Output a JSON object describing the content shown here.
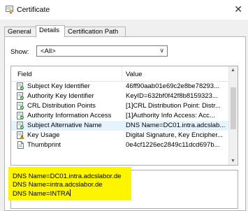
{
  "window": {
    "title": "Certificate"
  },
  "tabs": [
    "General",
    "Details",
    "Certification Path"
  ],
  "show": {
    "label": "Show:",
    "value": "<All>"
  },
  "list": {
    "columns": [
      "Field",
      "Value"
    ],
    "rows": [
      {
        "field": "Subject Key Identifier",
        "value": "46ff90aab01e69c2e8be78293...",
        "icon": "extension-icon"
      },
      {
        "field": "Authority Key Identifier",
        "value": "KeyID=632bf0f42f8b8159323...",
        "icon": "extension-icon"
      },
      {
        "field": "CRL Distribution Points",
        "value": "[1]CRL Distribution Point: Distr...",
        "icon": "extension-icon"
      },
      {
        "field": "Authority Information Access",
        "value": "[1]Authority Info Access: Acc...",
        "icon": "extension-icon"
      },
      {
        "field": "Subject Alternative Name",
        "value": "DNS Name=DC01.intra.adcslab...",
        "icon": "extension-icon",
        "selected": true
      },
      {
        "field": "Key Usage",
        "value": "Digital Signature, Key Encipher...",
        "icon": "critical-extension-icon"
      },
      {
        "field": "Thumbprint",
        "value": "0e4cf1226ec2849c11dcd697b...",
        "icon": "document-icon"
      }
    ]
  },
  "detail": {
    "lines": [
      "DNS Name=DC01.intra.adcslabor.de",
      "DNS Name=intra.adcslabor.de",
      "DNS Name=INTRA"
    ]
  },
  "colors": {
    "highlight": "#fdf500",
    "selection": "#e5f3ff"
  }
}
